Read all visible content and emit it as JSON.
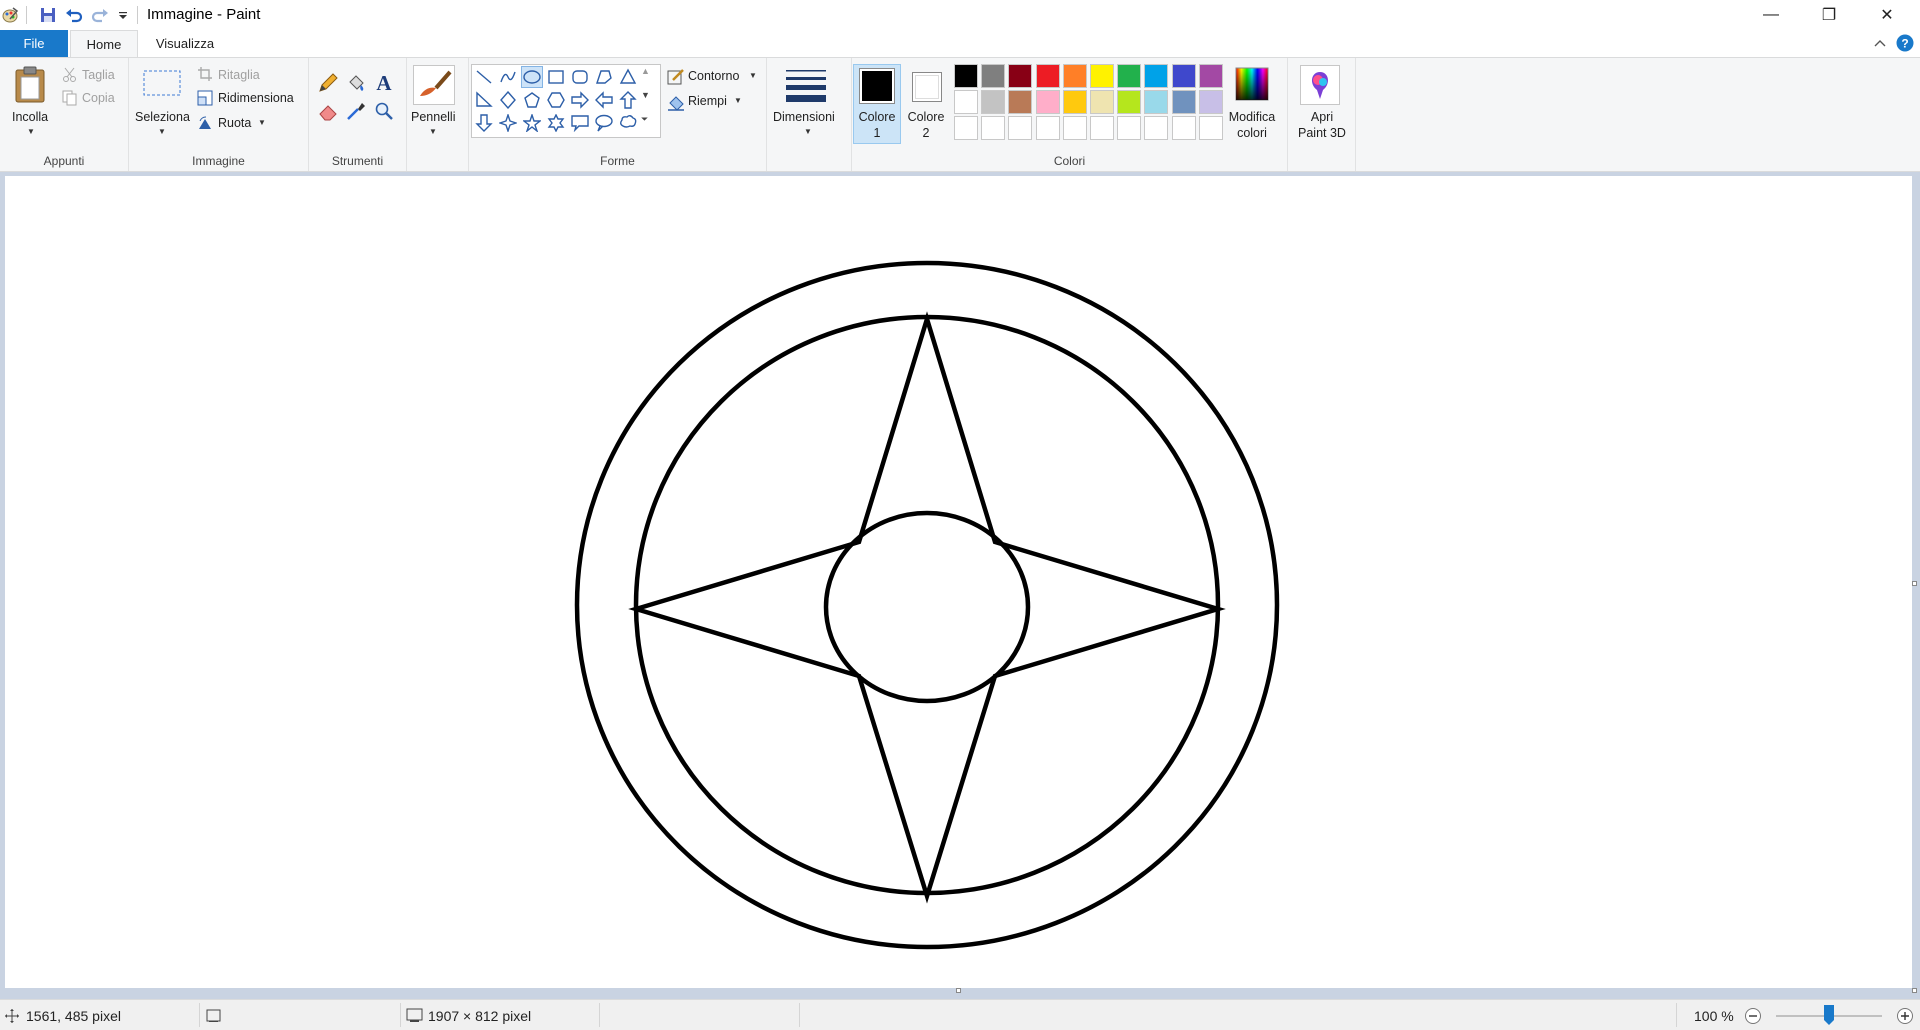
{
  "window": {
    "title": "Immagine - Paint",
    "minimize": "—",
    "maximize": "❐",
    "close": "✕"
  },
  "tabs": {
    "file": "File",
    "home": "Home",
    "view": "Visualizza"
  },
  "ribbon": {
    "clipboard": {
      "label": "Appunti",
      "paste": "Incolla",
      "cut": "Taglia",
      "copy": "Copia"
    },
    "image": {
      "label": "Immagine",
      "select": "Seleziona",
      "crop": "Ritaglia",
      "resize": "Ridimensiona",
      "rotate": "Ruota"
    },
    "tools": {
      "label": "Strumenti"
    },
    "brushes": {
      "label": "Pennelli"
    },
    "shapes": {
      "label": "Forme",
      "outline": "Contorno",
      "fill": "Riempi"
    },
    "size": {
      "label": "Dimensioni"
    },
    "colors": {
      "label": "Colori",
      "color1_line1": "Colore",
      "color1_line2": "1",
      "color2_line1": "Colore",
      "color2_line2": "2",
      "edit_line1": "Modifica",
      "edit_line2": "colori",
      "row1": [
        "#000000",
        "#7f7f7f",
        "#880015",
        "#ed1c24",
        "#ff7f27",
        "#fff200",
        "#22b14c",
        "#00a2e8",
        "#3f48cc",
        "#a349a4"
      ],
      "row2": [
        "#ffffff",
        "#c3c3c3",
        "#b97a57",
        "#ffaec9",
        "#ffc90e",
        "#efe4b0",
        "#b5e61d",
        "#99d9ea",
        "#7092be",
        "#c8bfe7"
      ],
      "color1": "#000000",
      "color2": "#ffffff"
    },
    "paint3d": {
      "line1": "Apri",
      "line2": "Paint 3D"
    }
  },
  "status": {
    "cursor_position": "1561, 485 pixel",
    "image_size": "1907 × 812 pixel",
    "zoom": "100 %"
  },
  "icons": [
    "paint-app-icon",
    "save-icon",
    "undo-icon",
    "redo-icon",
    "customize-icon",
    "paste-icon",
    "cut-icon",
    "copy-icon",
    "select-icon",
    "crop-icon",
    "resize-icon",
    "rotate-icon",
    "pencil-icon",
    "fill-icon",
    "text-icon",
    "eraser-icon",
    "color-picker-icon",
    "magnifier-icon",
    "brush-icon",
    "size-icon",
    "edit-colors-icon",
    "paint3d-icon",
    "help-icon",
    "collapse-ribbon-icon",
    "move-icon",
    "selection-size-icon",
    "canvas-size-icon",
    "zoom-out-icon",
    "zoom-in-icon"
  ]
}
